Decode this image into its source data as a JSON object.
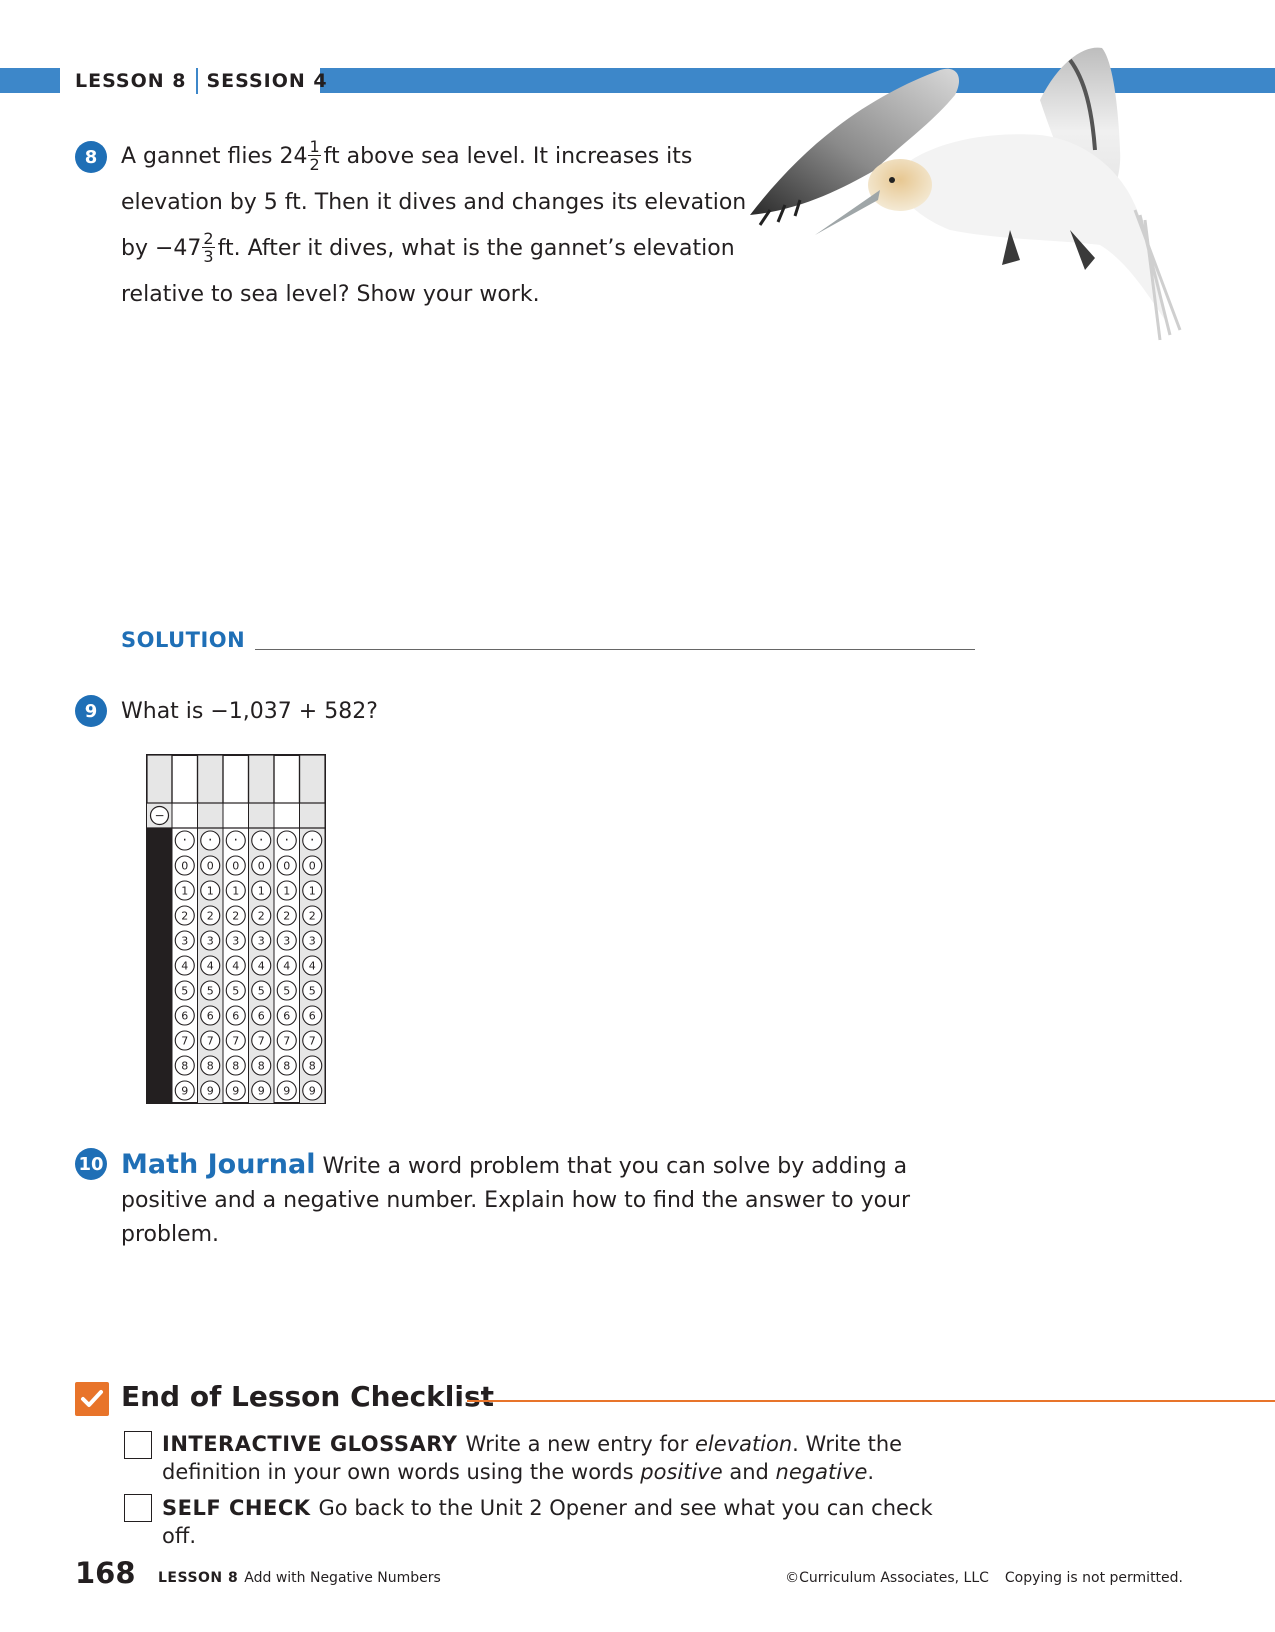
{
  "header": {
    "lesson": "LESSON 8",
    "session": "SESSION 4"
  },
  "colors": {
    "accent_blue": "#3d87c9",
    "number_blue": "#1f6fb6",
    "checklist_orange": "#e8742a"
  },
  "q8": {
    "number": "8",
    "line1_a": "A gannet flies 24",
    "frac1_num": "1",
    "frac1_den": "2",
    "line1_b": "ft above sea level. It increases its",
    "line2": "elevation by 5 ft. Then it dives and changes its elevation",
    "line3_a": "by −47",
    "frac2_num": "2",
    "frac2_den": "3",
    "line3_b": "ft. After it dives, what is the gannet’s elevation",
    "line4": "relative to sea level? Show your work.",
    "solution_label": "SOLUTION"
  },
  "q9": {
    "number": "9",
    "text": "What is −1,037 + 582?",
    "minus_symbol": "−",
    "decimal_symbol": "·",
    "digits": [
      "0",
      "1",
      "2",
      "3",
      "4",
      "5",
      "6",
      "7",
      "8",
      "9"
    ]
  },
  "q10": {
    "number": "10",
    "title": "Math Journal",
    "text": "Write a word problem that you can solve by adding a positive and a negative number. Explain how to find the answer to your problem."
  },
  "checklist": {
    "title": "End of Lesson Checklist",
    "item1": {
      "label": "INTERACTIVE GLOSSARY",
      "t1": "Write a new entry for",
      "e1": "elevation",
      "t2": ". Write the definition in your own words using the words",
      "e2": "positive",
      "t3": "and",
      "e3": "negative",
      "t4": "."
    },
    "item2": {
      "label": "SELF CHECK",
      "text": "Go back to the Unit 2 Opener and see what you can check off."
    }
  },
  "footer": {
    "page_number": "168",
    "lesson_label": "LESSON 8",
    "lesson_title": "Add with Negative Numbers",
    "copyright": "©Curriculum Associates, LLC",
    "notice": "Copying is not permitted."
  }
}
